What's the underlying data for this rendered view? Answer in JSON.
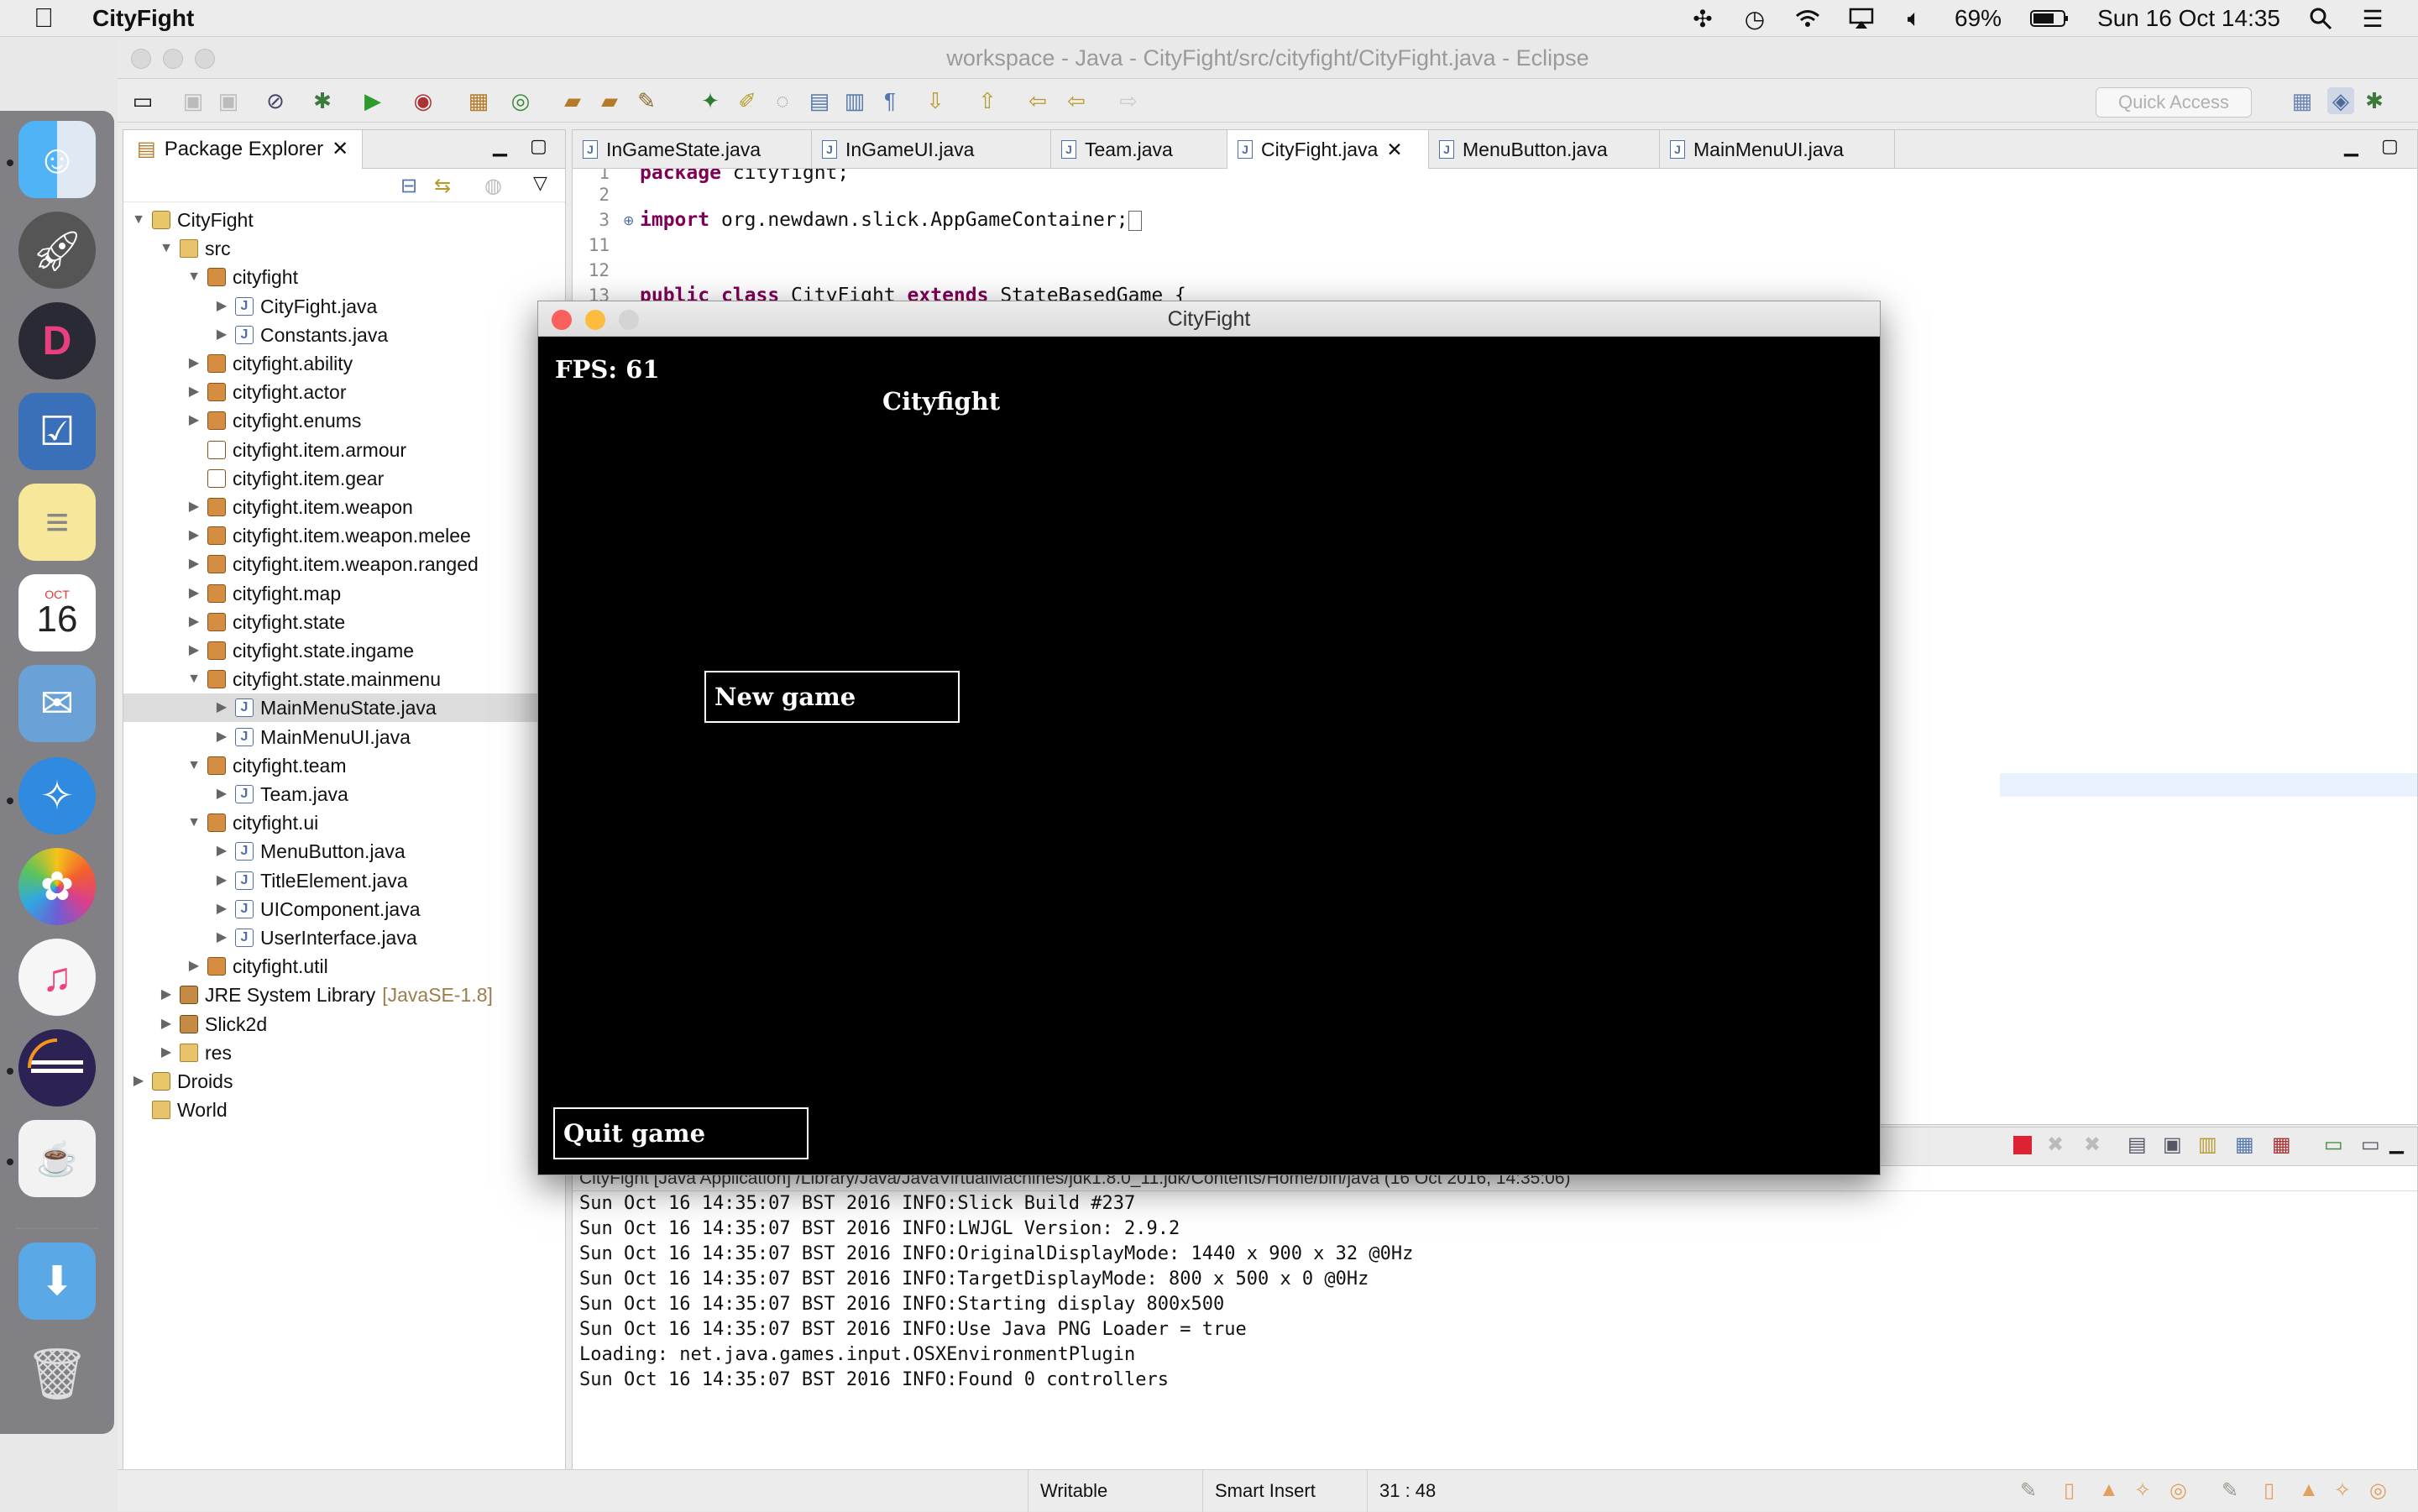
{
  "menubar": {
    "app_name": "CityFight",
    "battery": "69%",
    "datetime": "Sun 16 Oct  14:35"
  },
  "dock": {
    "calendar_month": "OCT",
    "calendar_day": "16",
    "icons": [
      "finder-icon",
      "launchpad-icon",
      "deskpad-icon",
      "things-icon",
      "notes-icon",
      "calendar-icon",
      "mail-icon",
      "safari-icon",
      "photos-icon",
      "itunes-icon",
      "eclipse-icon",
      "java-icon",
      "downloads-folder-icon",
      "trash-icon"
    ]
  },
  "eclipse": {
    "title": "workspace - Java - CityFight/src/cityfight/CityFight.java - Eclipse",
    "quick_access_placeholder": "Quick Access"
  },
  "package_explorer": {
    "tab_label": "Package Explorer",
    "items": [
      {
        "label": "CityFight",
        "suffix": ""
      },
      {
        "label": "src",
        "suffix": ""
      },
      {
        "label": "cityfight",
        "suffix": ""
      },
      {
        "label": "CityFight.java",
        "suffix": ""
      },
      {
        "label": "Constants.java",
        "suffix": ""
      },
      {
        "label": "cityfight.ability",
        "suffix": ""
      },
      {
        "label": "cityfight.actor",
        "suffix": ""
      },
      {
        "label": "cityfight.enums",
        "suffix": ""
      },
      {
        "label": "cityfight.item.armour",
        "suffix": ""
      },
      {
        "label": "cityfight.item.gear",
        "suffix": ""
      },
      {
        "label": "cityfight.item.weapon",
        "suffix": ""
      },
      {
        "label": "cityfight.item.weapon.melee",
        "suffix": ""
      },
      {
        "label": "cityfight.item.weapon.ranged",
        "suffix": ""
      },
      {
        "label": "cityfight.map",
        "suffix": ""
      },
      {
        "label": "cityfight.state",
        "suffix": ""
      },
      {
        "label": "cityfight.state.ingame",
        "suffix": ""
      },
      {
        "label": "cityfight.state.mainmenu",
        "suffix": ""
      },
      {
        "label": "MainMenuState.java",
        "suffix": ""
      },
      {
        "label": "MainMenuUI.java",
        "suffix": ""
      },
      {
        "label": "cityfight.team",
        "suffix": ""
      },
      {
        "label": "Team.java",
        "suffix": ""
      },
      {
        "label": "cityfight.ui",
        "suffix": ""
      },
      {
        "label": "MenuButton.java",
        "suffix": ""
      },
      {
        "label": "TitleElement.java",
        "suffix": ""
      },
      {
        "label": "UIComponent.java",
        "suffix": ""
      },
      {
        "label": "UserInterface.java",
        "suffix": ""
      },
      {
        "label": "cityfight.util",
        "suffix": ""
      },
      {
        "label": "JRE System Library",
        "suffix": "[JavaSE-1.8]"
      },
      {
        "label": "Slick2d",
        "suffix": ""
      },
      {
        "label": "res",
        "suffix": ""
      },
      {
        "label": "Droids",
        "suffix": ""
      },
      {
        "label": "World",
        "suffix": ""
      }
    ]
  },
  "editor": {
    "tabs": [
      "InGameState.java",
      "InGameUI.java",
      "Team.java",
      "CityFight.java",
      "MenuButton.java",
      "MainMenuUI.java"
    ],
    "active_tab": "CityFight.java",
    "lines": [
      {
        "num": "1",
        "text": "package cityfight;"
      },
      {
        "num": "2",
        "text": ""
      },
      {
        "num": "3",
        "text": "import org.newdawn.slick.AppGameContainer;"
      },
      {
        "num": "11",
        "text": ""
      },
      {
        "num": "12",
        "text": ""
      },
      {
        "num": "13",
        "text": "public class CityFight extends StateBasedGame {"
      }
    ]
  },
  "console": {
    "description": "CityFight [Java Application] /Library/Java/JavaVirtualMachines/jdk1.8.0_11.jdk/Contents/Home/bin/java (16 Oct 2016, 14:35:06)",
    "lines": [
      "Sun Oct 16 14:35:07 BST 2016 INFO:Slick Build #237",
      "Sun Oct 16 14:35:07 BST 2016 INFO:LWJGL Version: 2.9.2",
      "Sun Oct 16 14:35:07 BST 2016 INFO:OriginalDisplayMode: 1440 x 900 x 32 @0Hz",
      "Sun Oct 16 14:35:07 BST 2016 INFO:TargetDisplayMode: 800 x 500 x 0 @0Hz",
      "Sun Oct 16 14:35:07 BST 2016 INFO:Starting display 800x500",
      "Sun Oct 16 14:35:07 BST 2016 INFO:Use Java PNG Loader = true",
      "Loading: net.java.games.input.OSXEnvironmentPlugin",
      "Sun Oct 16 14:35:07 BST 2016 INFO:Found 0 controllers"
    ]
  },
  "status": {
    "writable": "Writable",
    "insert_mode": "Smart Insert",
    "position": "31 : 48"
  },
  "game": {
    "window_title": "CityFight",
    "fps": "FPS: 61",
    "title": "Cityfight",
    "new_game": "New game",
    "quit_game": "Quit game"
  },
  "colors": {
    "keyword": "#7f0055",
    "close": "#fc605c",
    "minimize": "#fdbc40",
    "zoom": "#34c84a"
  }
}
